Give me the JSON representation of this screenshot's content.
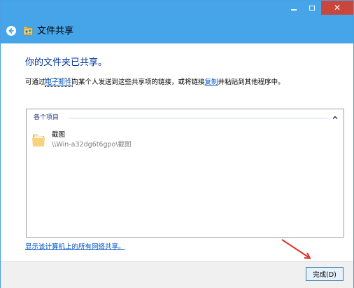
{
  "window": {
    "title": "文件共享",
    "controls": {
      "minimize": "minimize",
      "maximize": "maximize",
      "close": "close"
    }
  },
  "icons": {
    "back": "back-arrow-icon",
    "share": "file-share-icon",
    "folder": "folder-icon",
    "collapse": "chevron-up-icon"
  },
  "content": {
    "heading": "你的文件夹已共享。",
    "desc_prefix": "可通过",
    "desc_email_link": "电子邮件",
    "desc_middle": "向某个人发送到这些共享项的链接，或将链接",
    "desc_copy_link": "复制",
    "desc_suffix": "并粘贴到其他程序中。"
  },
  "list": {
    "group_label": "各个项目",
    "items": [
      {
        "name": "截图",
        "path": "\\\\Win-a32dg6t6gpo\\截图"
      }
    ]
  },
  "bottom_link": "显示该计算机上的所有网络共享。",
  "footer": {
    "finish_button": "完成(D)"
  },
  "colors": {
    "titlebar": "#46a4e9",
    "close_button": "#c9463d",
    "heading": "#003399",
    "link": "#0055c8",
    "annotation_arrow": "#d9342b"
  }
}
